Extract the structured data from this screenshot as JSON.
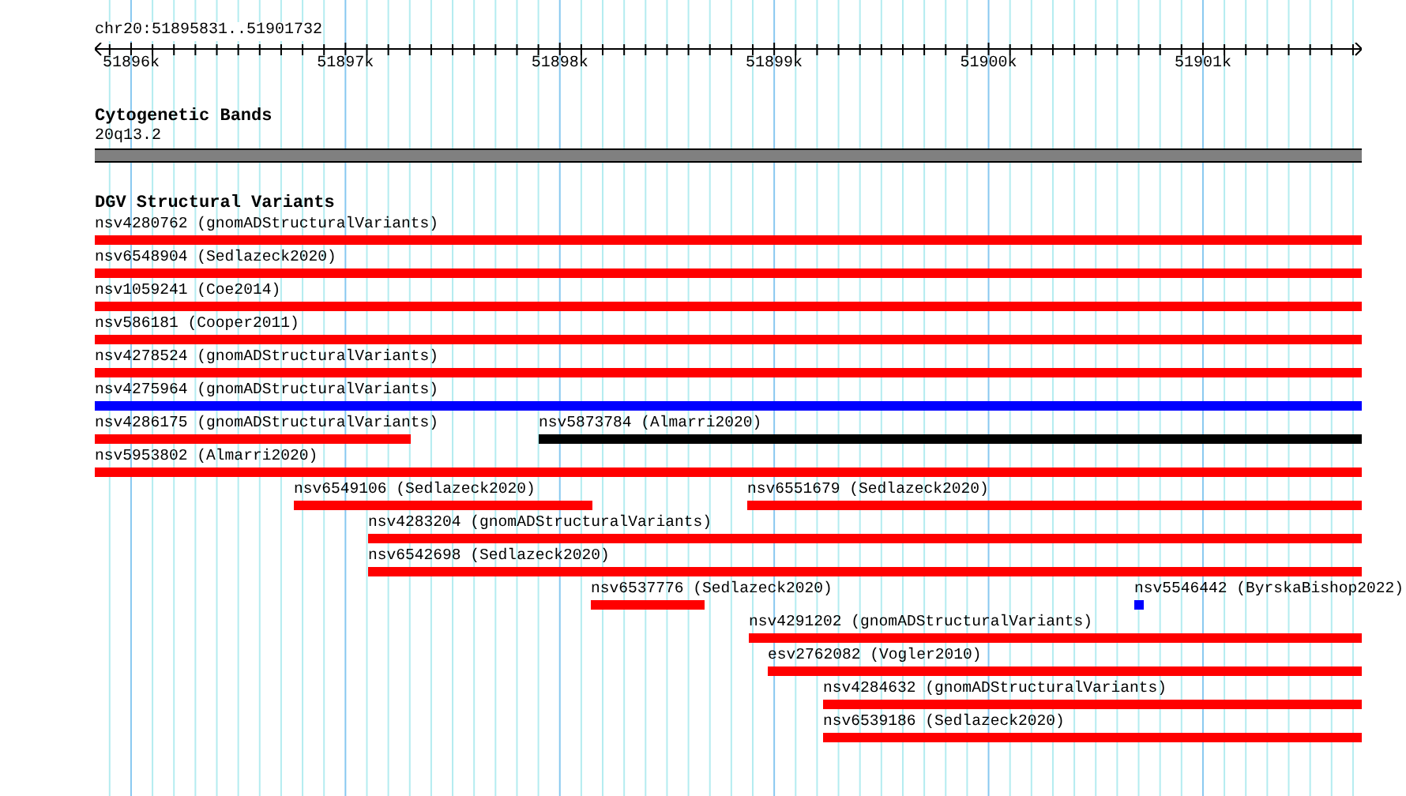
{
  "ruler": {
    "label": "chr20:51895831..51901732",
    "ticks": [
      "51896k",
      "51897k",
      "51898k",
      "51899k",
      "51900k",
      "51901k"
    ]
  },
  "cytoband_track": {
    "title": "Cytogenetic Bands",
    "band": "20q13.2"
  },
  "variants_track": {
    "title": "DGV Structural Variants",
    "rows": [
      {
        "features": [
          {
            "label": "nsv4280762 (gnomADStructuralVariants)",
            "color": "#ff0000"
          }
        ]
      },
      {
        "features": [
          {
            "label": "nsv6548904 (Sedlazeck2020)",
            "color": "#ff0000"
          }
        ]
      },
      {
        "features": [
          {
            "label": "nsv1059241 (Coe2014)",
            "color": "#ff0000"
          }
        ]
      },
      {
        "features": [
          {
            "label": "nsv586181 (Cooper2011)",
            "color": "#ff0000"
          }
        ]
      },
      {
        "features": [
          {
            "label": "nsv4278524 (gnomADStructuralVariants)",
            "color": "#ff0000"
          }
        ]
      },
      {
        "features": [
          {
            "label": "nsv4275964 (gnomADStructuralVariants)",
            "color": "#0000ff"
          }
        ]
      },
      {
        "features": [
          {
            "label": "nsv4286175 (gnomADStructuralVariants)",
            "color": "#ff0000"
          },
          {
            "label": "nsv5873784 (Almarri2020)",
            "color": "#000000"
          }
        ]
      },
      {
        "features": [
          {
            "label": "nsv5953802 (Almarri2020)",
            "color": "#ff0000"
          }
        ]
      },
      {
        "features": [
          {
            "label": "nsv6549106 (Sedlazeck2020)",
            "color": "#ff0000"
          },
          {
            "label": "nsv6551679 (Sedlazeck2020)",
            "color": "#ff0000"
          }
        ]
      },
      {
        "features": [
          {
            "label": "nsv4283204 (gnomADStructuralVariants)",
            "color": "#ff0000"
          }
        ]
      },
      {
        "features": [
          {
            "label": "nsv6542698 (Sedlazeck2020)",
            "color": "#ff0000"
          }
        ]
      },
      {
        "features": [
          {
            "label": "nsv6537776 (Sedlazeck2020)",
            "color": "#ff0000"
          },
          {
            "label": "nsv5546442 (ByrskaBishop2022)",
            "color": "#0000ff"
          }
        ]
      },
      {
        "features": [
          {
            "label": "nsv4291202 (gnomADStructuralVariants)",
            "color": "#ff0000"
          }
        ]
      },
      {
        "features": [
          {
            "label": "esv2762082 (Vogler2010)",
            "color": "#ff0000"
          }
        ]
      },
      {
        "features": [
          {
            "label": "nsv4284632 (gnomADStructuralVariants)",
            "color": "#ff0000"
          }
        ]
      },
      {
        "features": [
          {
            "label": "nsv6539186 (Sedlazeck2020)",
            "color": "#ff0000"
          }
        ]
      }
    ]
  }
}
